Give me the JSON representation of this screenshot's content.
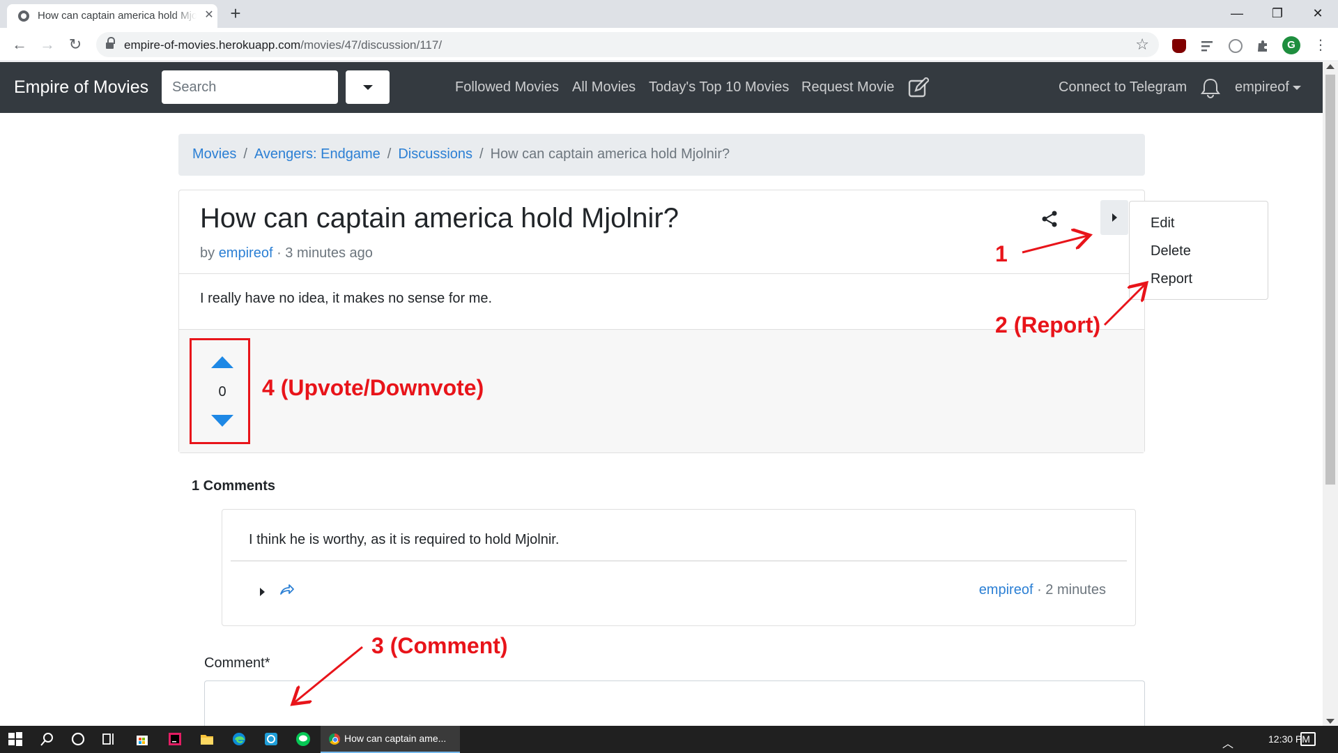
{
  "browser": {
    "tab_title": "How can captain america hold Mjolnir?",
    "new_tab_symbol": "+",
    "close_symbol": "✕",
    "url_host": "empire-of-movies.herokuapp.com",
    "url_path": "/movies/47/discussion/117/",
    "window_controls": {
      "minimize": "—",
      "maximize": "❐",
      "close": "✕"
    },
    "profile_initial": "G"
  },
  "navbar": {
    "brand": "Empire of Movies",
    "search_placeholder": "Search",
    "links": [
      "Followed Movies",
      "All Movies",
      "Today's Top 10 Movies",
      "Request Movie"
    ],
    "telegram": "Connect to Telegram",
    "username": "empireof"
  },
  "breadcrumb": {
    "items": [
      "Movies",
      "Avengers: Endgame",
      "Discussions"
    ],
    "current": "How can captain america hold Mjolnir?",
    "separator": "/"
  },
  "discussion": {
    "title": "How can captain america hold Mjolnir?",
    "by_label": "by",
    "author": "empireof",
    "time": "· 3 minutes ago",
    "body": "I really have no idea, it makes no sense for me.",
    "votes": "0"
  },
  "dropdown_menu": {
    "items": [
      "Edit",
      "Delete",
      "Report"
    ]
  },
  "comments": {
    "count_label": "1 Comments",
    "items": [
      {
        "text": "I think he is worthy, as it is required to hold Mjolnir.",
        "author": "empireof",
        "time": "· 2 minutes"
      }
    ],
    "form_label": "Comment*"
  },
  "annotations": {
    "one": "1",
    "two": "2 (Report)",
    "three": "3 (Comment)",
    "four": "4 (Upvote/Downvote)",
    "color": "#e8141a"
  },
  "taskbar": {
    "app_label": "How can captain ame...",
    "clock": "12:30 PM"
  },
  "colors": {
    "navbar_bg": "#343a40",
    "link": "#2b7fd4",
    "vote_arrow": "#1e88e5"
  }
}
